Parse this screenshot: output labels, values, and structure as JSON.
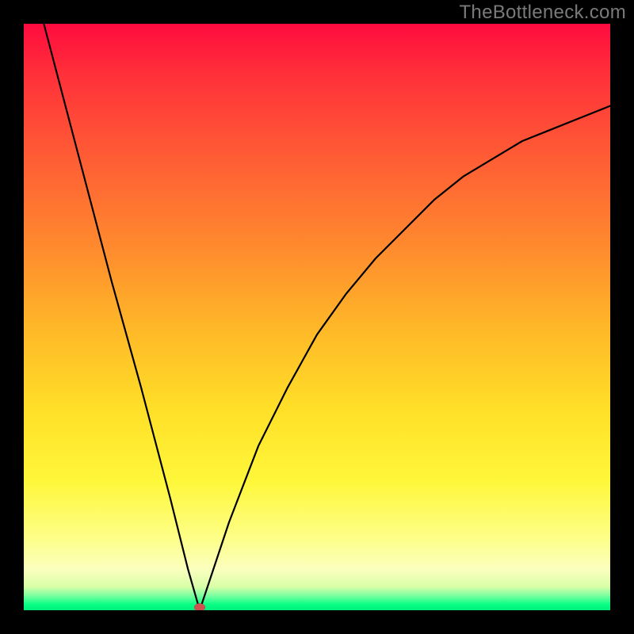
{
  "watermark": "TheBottleneck.com",
  "colors": {
    "background": "#000000",
    "curve": "#000000",
    "marker": "#d05050",
    "gradient_top": "#ff0b3e",
    "gradient_bottom": "#00f07c"
  },
  "chart_data": {
    "type": "line",
    "title": "",
    "xlabel": "",
    "ylabel": "",
    "xlim": [
      0,
      100
    ],
    "ylim": [
      0,
      100
    ],
    "notes": "V-shaped bottleneck curve over vertical severity gradient (red=high bottleneck, green=no bottleneck). Curve touches 0 at x≈30, rises steeply left and with diminishing slope to the right.",
    "x": [
      0,
      5,
      10,
      15,
      20,
      25,
      28,
      30,
      32,
      35,
      40,
      45,
      50,
      55,
      60,
      65,
      70,
      75,
      80,
      85,
      90,
      95,
      100
    ],
    "y": [
      113,
      94,
      75,
      56,
      38,
      19,
      7,
      0,
      6,
      15,
      28,
      38,
      47,
      54,
      60,
      65,
      70,
      74,
      77,
      80,
      82,
      84,
      86
    ],
    "minimum": {
      "x": 30,
      "y": 0
    },
    "marker": {
      "x": 30,
      "y": 0.5
    }
  }
}
